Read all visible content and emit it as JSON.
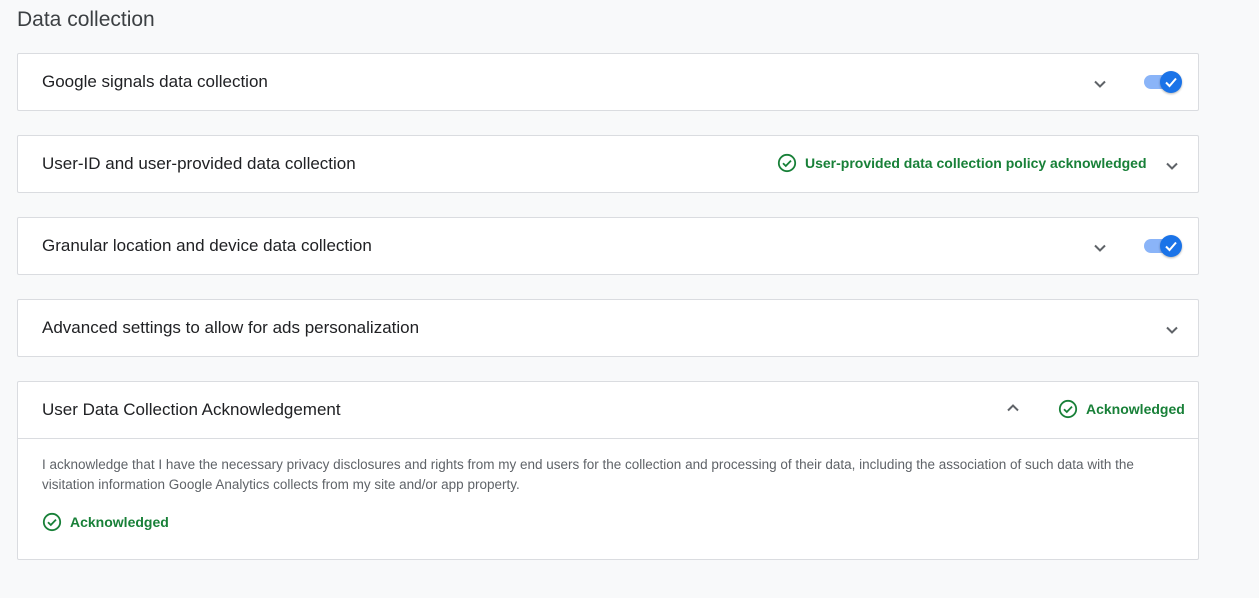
{
  "page": {
    "title": "Data collection"
  },
  "panels": [
    {
      "title": "Google signals data collection",
      "toggle_on": true
    },
    {
      "title": "User-ID and user-provided data collection",
      "status": "User-provided data collection policy acknowledged"
    },
    {
      "title": "Granular location and device data collection",
      "toggle_on": true
    },
    {
      "title": "Advanced settings to allow for ads personalization"
    },
    {
      "title": "User Data Collection Acknowledgement",
      "status": "Acknowledged",
      "body": "I acknowledge that I have the necessary privacy disclosures and rights from my end users for the collection and processing of their data, including the association of such data with the visitation information Google Analytics collects from my site and/or app property.",
      "body_status": "Acknowledged"
    }
  ],
  "icons": {
    "chevron": "chevron-down-icon",
    "chevron_up": "chevron-up-icon",
    "check_circle": "check-circle-icon",
    "check": "check-icon"
  },
  "colors": {
    "accent": "#1a73e8",
    "accent_light": "#8ab4f8",
    "success": "#188038",
    "border": "#dadce0",
    "background": "#f8f9fa"
  }
}
